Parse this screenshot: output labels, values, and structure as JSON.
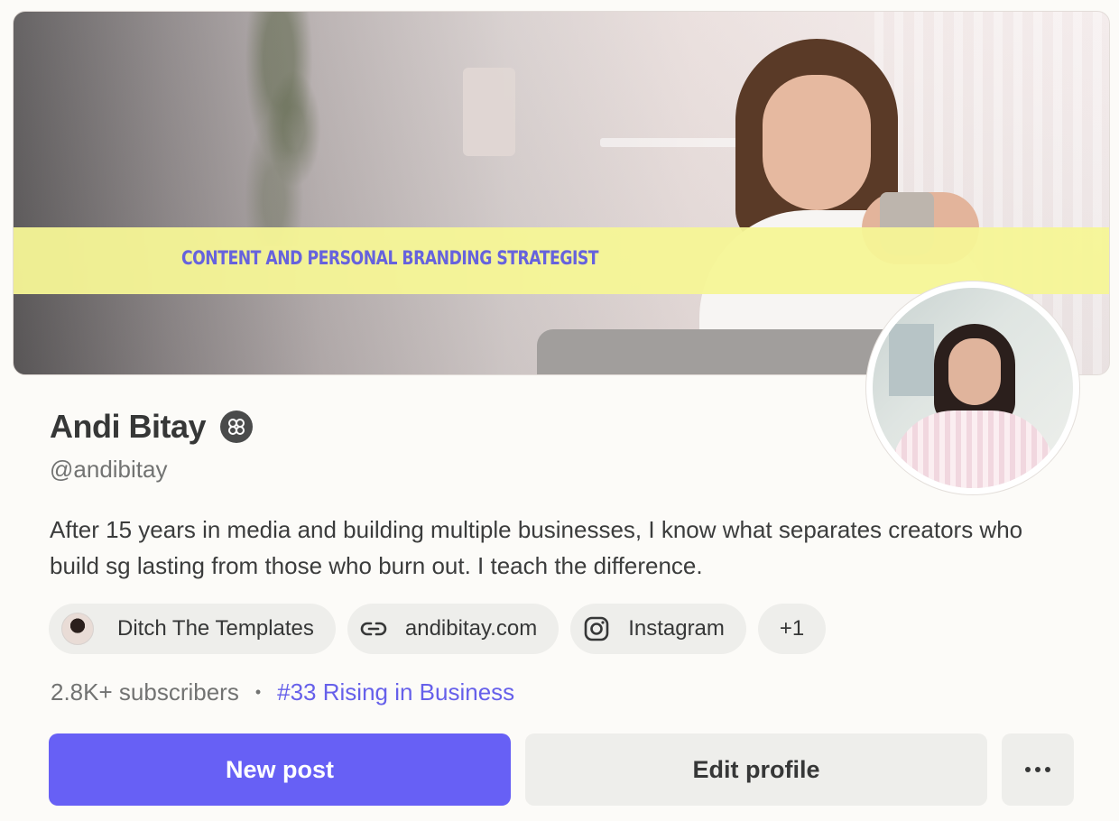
{
  "banner": {
    "tagline": "CONTENT AND PERSONAL BRANDING STRATEGIST"
  },
  "profile": {
    "name": "Andi Bitay",
    "handle": "@andibitay",
    "bio": "After 15 years in media and building multiple businesses, I know what separates creators who build sg lasting from those who burn out. I teach the difference.",
    "verified_icon": "bestseller-badge-icon"
  },
  "links": [
    {
      "label": "Ditch The Templates",
      "icon": "publication-avatar"
    },
    {
      "label": "andibitay.com",
      "icon": "link-icon"
    },
    {
      "label": "Instagram",
      "icon": "instagram-icon"
    }
  ],
  "links_more": "+1",
  "stats": {
    "subscribers": "2.8K+ subscribers",
    "separator": "•",
    "rank": "#33 Rising in Business"
  },
  "actions": {
    "primary": "New post",
    "secondary": "Edit profile",
    "more_icon": "more-horizontal-icon"
  },
  "colors": {
    "accent": "#6760f5",
    "rank_link": "#6660ea",
    "banner_strip": "#f6f596",
    "banner_text": "#6662dd",
    "chip_bg": "#eeeeeb"
  }
}
